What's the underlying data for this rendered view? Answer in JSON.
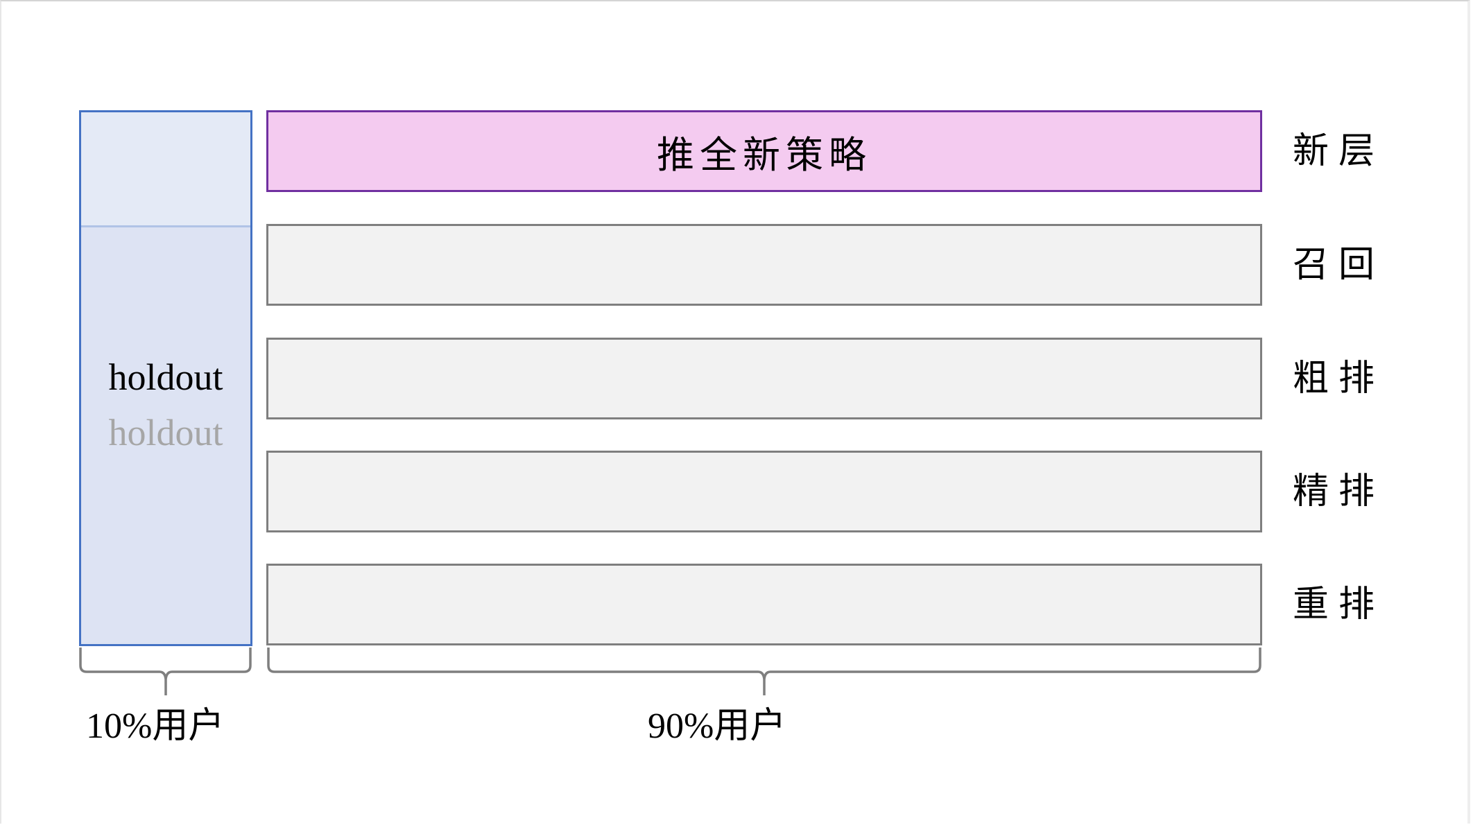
{
  "diagram": {
    "holdout": {
      "label_primary": "holdout",
      "label_secondary": "holdout",
      "border_color": "#4472c4",
      "fill_color": "#dde3f3"
    },
    "layers": [
      {
        "key": "new",
        "text": "推全新策略",
        "side_label": "新层",
        "highlight": true
      },
      {
        "key": "recall",
        "text": "",
        "side_label": "召回",
        "highlight": false
      },
      {
        "key": "pre-rank",
        "text": "",
        "side_label": "粗排",
        "highlight": false
      },
      {
        "key": "rank",
        "text": "",
        "side_label": "精排",
        "highlight": false
      },
      {
        "key": "rerank",
        "text": "",
        "side_label": "重排",
        "highlight": false
      }
    ],
    "colors": {
      "highlight_fill": "#f4cbf0",
      "highlight_border": "#7030a0",
      "layer_fill": "#f2f2f2",
      "layer_border": "#7f7f7f",
      "bracket": "#7f7f7f"
    },
    "brackets": [
      {
        "key": "holdout-share",
        "label": "10%用户",
        "share_percent": 10
      },
      {
        "key": "experiment-share",
        "label": "90%用户",
        "share_percent": 90
      }
    ]
  }
}
